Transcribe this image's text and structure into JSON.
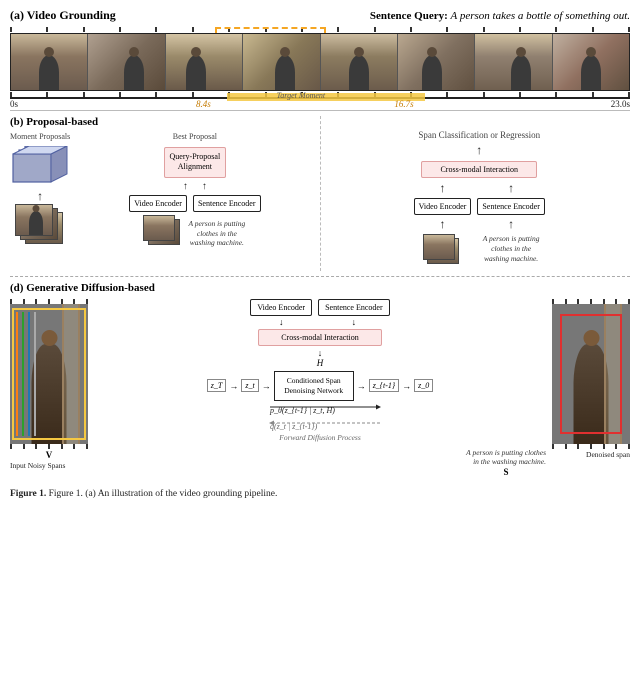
{
  "header": {
    "section_a_label": "(a) Video Grounding",
    "sentence_query_label": "Sentence Query:",
    "sentence_query_text": "A person takes a bottle of something out."
  },
  "timeline": {
    "time_start": "0s",
    "time_mid": "8.4s",
    "time_target": "Target Moment",
    "time_end_mid": "16.7s",
    "time_end": "23.0s"
  },
  "section_b": {
    "label": "(b) Proposal-based",
    "moment_proposals_label": "Moment Proposals",
    "best_proposal_label": "Best Proposal",
    "query_proposal_box": "Query-Proposal\nAlignment",
    "video_encoder_label": "Video Encoder",
    "sentence_encoder_label": "Sentence Encoder",
    "caption_left": "A person is putting clothes\nin the washing machine.",
    "cross_modal_label": "Cross-modal Interaction",
    "span_class_label": "Span Classification or Regression",
    "caption_right": "A person is putting clothes\nin the washing machine."
  },
  "section_d": {
    "label": "(d) Generative Diffusion-based",
    "video_encoder_label": "Video Encoder",
    "sentence_encoder_label": "Sentence Encoder",
    "cross_modal_label": "Cross-modal Interaction",
    "v_label": "V",
    "s_label": "S",
    "h_label": "H",
    "p_label": "p_θ(z_{t-1} | z_t, H)",
    "q_label": "q(z_t | z_{t-1})",
    "conditioned_span_box": "Conditioned Span\nDenoising Network",
    "forward_label": "Forward Diffusion Process",
    "input_noisy_label": "Input Noisy\nSpans",
    "denoised_label": "Denoised\nspan",
    "z_T": "z_T",
    "z_t_in": "z_t",
    "z_t_out": "z_{t-1}",
    "z_0": "z_0",
    "sentence_caption": "A person is putting clothes\nin the washing machine."
  },
  "figure_caption": {
    "text": "Figure 1. (a) An illustration of the video grounding pipeline."
  }
}
